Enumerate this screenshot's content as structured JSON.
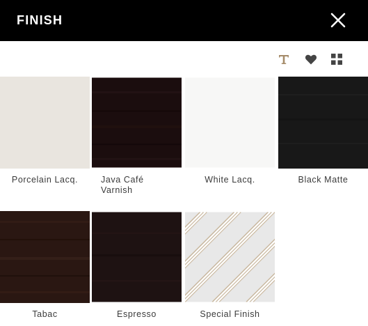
{
  "header": {
    "title": "FINISH",
    "close_icon": "close-icon"
  },
  "toolbar": {
    "icons": [
      "text-icon",
      "heart-icon",
      "grid-icon"
    ],
    "accent_color": "#a58b69",
    "icon_color": "#444444"
  },
  "swatches": [
    {
      "label": "Porcelain Lacq.",
      "color": "#e6e2dc"
    },
    {
      "label": "Java Café\nVarnish",
      "color": "#1b0d0e"
    },
    {
      "label": "White Lacq.",
      "color": "#f7f7f6"
    },
    {
      "label": "Black Matte",
      "color": "#181818"
    },
    {
      "label": "Tabac",
      "color": "#2a1712"
    },
    {
      "label": "Espresso",
      "color": "#1e1212"
    },
    {
      "label": "Special Finish",
      "color": "#e8e8e8"
    }
  ]
}
